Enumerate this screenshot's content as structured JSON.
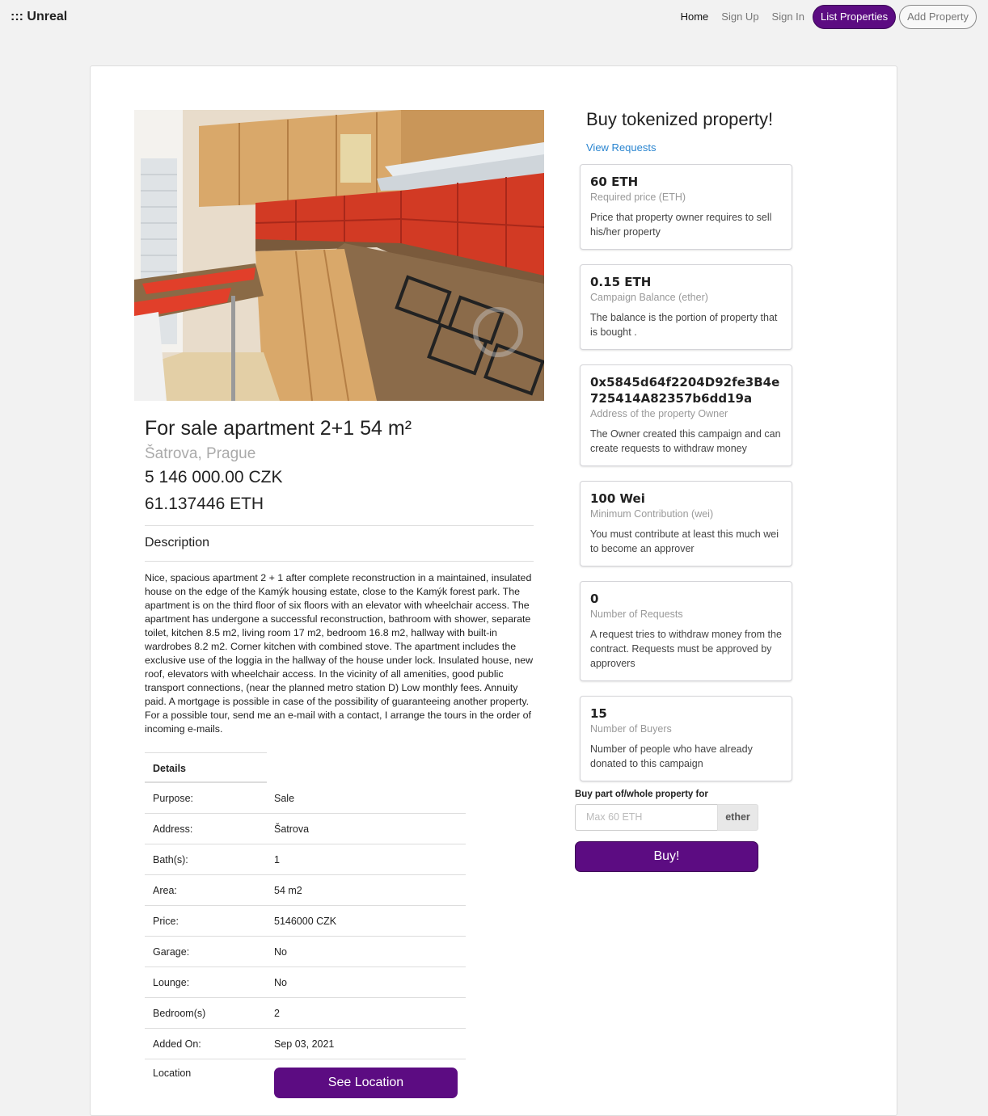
{
  "nav": {
    "brand": "::: Unreal",
    "home": "Home",
    "signup": "Sign Up",
    "signin": "Sign In",
    "list_properties": "List Properties",
    "add_property": "Add Property"
  },
  "property": {
    "title": "For sale apartment 2+1 54 m²",
    "location": "Šatrova, Prague",
    "price_czk": "5 146 000.00 CZK",
    "price_eth": "61.137446 ETH",
    "description_heading": "Description",
    "description": "Nice, spacious apartment 2 + 1 after complete reconstruction in a maintained, insulated house on the edge of the Kamýk housing estate, close to the Kamýk forest park. The apartment is on the third floor of six floors with an elevator with wheelchair access. The apartment has undergone a successful reconstruction, bathroom with shower, separate toilet, kitchen 8.5 m2, living room 17 m2, bedroom 16.8 m2, hallway with built-in wardrobes 8.2 m2. Corner kitchen with combined stove. The apartment includes the exclusive use of the loggia in the hallway of the house under lock. Insulated house, new roof, elevators with wheelchair access. In the vicinity of all amenities, good public transport connections, (near the planned metro station D) Low monthly fees. Annuity paid. A mortgage is possible in case of the possibility of guaranteeing another property. For a possible tour, send me an e-mail with a contact, I arrange the tours in the order of incoming e-mails.",
    "details_heading": "Details",
    "details": [
      {
        "label": "Purpose:",
        "value": "Sale"
      },
      {
        "label": "Address:",
        "value": "Šatrova"
      },
      {
        "label": "Bath(s):",
        "value": "1"
      },
      {
        "label": "Area:",
        "value": "54 m2"
      },
      {
        "label": "Price:",
        "value": "5146000 CZK"
      },
      {
        "label": "Garage:",
        "value": "No"
      },
      {
        "label": "Lounge:",
        "value": "No"
      },
      {
        "label": "Bedroom(s)",
        "value": "2"
      },
      {
        "label": "Added On:",
        "value": "Sep 03, 2021"
      }
    ],
    "location_label": "Location",
    "see_location": "See Location"
  },
  "campaign": {
    "heading": "Buy tokenized property!",
    "view_requests": "View Requests",
    "stats": [
      {
        "header": "60 ETH",
        "meta": "Required price (ETH)",
        "description": "Price that property owner requires to sell his/her property"
      },
      {
        "header": "0.15 ETH",
        "meta": "Campaign Balance (ether)",
        "description": "The balance is the portion of property that is bought ."
      },
      {
        "header": "0x5845d64f2204D92fe3B4e725414A82357b6dd19a",
        "meta": "Address of the property Owner",
        "description": "The Owner created this campaign and can create requests to withdraw money"
      },
      {
        "header": "100 Wei",
        "meta": "Minimum Contribution (wei)",
        "description": "You must contribute at least this much wei to become an approver"
      },
      {
        "header": "0",
        "meta": "Number of Requests",
        "description": "A request tries to withdraw money from the contract. Requests must be approved by approvers"
      },
      {
        "header": "15",
        "meta": "Number of Buyers",
        "description": "Number of people who have already donated to this campaign"
      }
    ],
    "buy_label": "Buy part of/whole property for",
    "buy_placeholder": "Max 60 ETH",
    "buy_unit": "ether",
    "buy_button": "Buy!"
  },
  "colors": {
    "accent": "#5c0c82",
    "link": "#2a85d0"
  }
}
